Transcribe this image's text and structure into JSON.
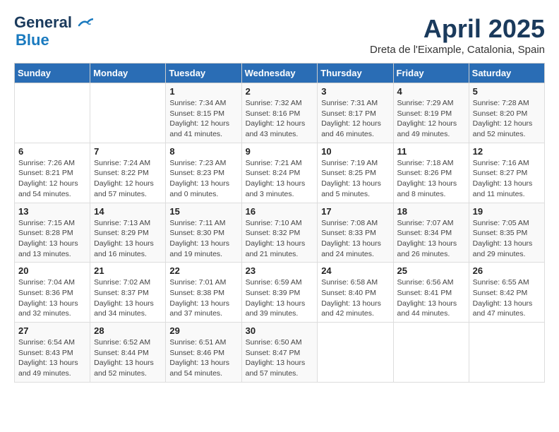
{
  "logo": {
    "line1": "General",
    "line2": "Blue"
  },
  "title": "April 2025",
  "location": "Dreta de l'Eixample, Catalonia, Spain",
  "weekdays": [
    "Sunday",
    "Monday",
    "Tuesday",
    "Wednesday",
    "Thursday",
    "Friday",
    "Saturday"
  ],
  "weeks": [
    [
      {
        "day": "",
        "info": ""
      },
      {
        "day": "",
        "info": ""
      },
      {
        "day": "1",
        "info": "Sunrise: 7:34 AM\nSunset: 8:15 PM\nDaylight: 12 hours and 41 minutes."
      },
      {
        "day": "2",
        "info": "Sunrise: 7:32 AM\nSunset: 8:16 PM\nDaylight: 12 hours and 43 minutes."
      },
      {
        "day": "3",
        "info": "Sunrise: 7:31 AM\nSunset: 8:17 PM\nDaylight: 12 hours and 46 minutes."
      },
      {
        "day": "4",
        "info": "Sunrise: 7:29 AM\nSunset: 8:19 PM\nDaylight: 12 hours and 49 minutes."
      },
      {
        "day": "5",
        "info": "Sunrise: 7:28 AM\nSunset: 8:20 PM\nDaylight: 12 hours and 52 minutes."
      }
    ],
    [
      {
        "day": "6",
        "info": "Sunrise: 7:26 AM\nSunset: 8:21 PM\nDaylight: 12 hours and 54 minutes."
      },
      {
        "day": "7",
        "info": "Sunrise: 7:24 AM\nSunset: 8:22 PM\nDaylight: 12 hours and 57 minutes."
      },
      {
        "day": "8",
        "info": "Sunrise: 7:23 AM\nSunset: 8:23 PM\nDaylight: 13 hours and 0 minutes."
      },
      {
        "day": "9",
        "info": "Sunrise: 7:21 AM\nSunset: 8:24 PM\nDaylight: 13 hours and 3 minutes."
      },
      {
        "day": "10",
        "info": "Sunrise: 7:19 AM\nSunset: 8:25 PM\nDaylight: 13 hours and 5 minutes."
      },
      {
        "day": "11",
        "info": "Sunrise: 7:18 AM\nSunset: 8:26 PM\nDaylight: 13 hours and 8 minutes."
      },
      {
        "day": "12",
        "info": "Sunrise: 7:16 AM\nSunset: 8:27 PM\nDaylight: 13 hours and 11 minutes."
      }
    ],
    [
      {
        "day": "13",
        "info": "Sunrise: 7:15 AM\nSunset: 8:28 PM\nDaylight: 13 hours and 13 minutes."
      },
      {
        "day": "14",
        "info": "Sunrise: 7:13 AM\nSunset: 8:29 PM\nDaylight: 13 hours and 16 minutes."
      },
      {
        "day": "15",
        "info": "Sunrise: 7:11 AM\nSunset: 8:30 PM\nDaylight: 13 hours and 19 minutes."
      },
      {
        "day": "16",
        "info": "Sunrise: 7:10 AM\nSunset: 8:32 PM\nDaylight: 13 hours and 21 minutes."
      },
      {
        "day": "17",
        "info": "Sunrise: 7:08 AM\nSunset: 8:33 PM\nDaylight: 13 hours and 24 minutes."
      },
      {
        "day": "18",
        "info": "Sunrise: 7:07 AM\nSunset: 8:34 PM\nDaylight: 13 hours and 26 minutes."
      },
      {
        "day": "19",
        "info": "Sunrise: 7:05 AM\nSunset: 8:35 PM\nDaylight: 13 hours and 29 minutes."
      }
    ],
    [
      {
        "day": "20",
        "info": "Sunrise: 7:04 AM\nSunset: 8:36 PM\nDaylight: 13 hours and 32 minutes."
      },
      {
        "day": "21",
        "info": "Sunrise: 7:02 AM\nSunset: 8:37 PM\nDaylight: 13 hours and 34 minutes."
      },
      {
        "day": "22",
        "info": "Sunrise: 7:01 AM\nSunset: 8:38 PM\nDaylight: 13 hours and 37 minutes."
      },
      {
        "day": "23",
        "info": "Sunrise: 6:59 AM\nSunset: 8:39 PM\nDaylight: 13 hours and 39 minutes."
      },
      {
        "day": "24",
        "info": "Sunrise: 6:58 AM\nSunset: 8:40 PM\nDaylight: 13 hours and 42 minutes."
      },
      {
        "day": "25",
        "info": "Sunrise: 6:56 AM\nSunset: 8:41 PM\nDaylight: 13 hours and 44 minutes."
      },
      {
        "day": "26",
        "info": "Sunrise: 6:55 AM\nSunset: 8:42 PM\nDaylight: 13 hours and 47 minutes."
      }
    ],
    [
      {
        "day": "27",
        "info": "Sunrise: 6:54 AM\nSunset: 8:43 PM\nDaylight: 13 hours and 49 minutes."
      },
      {
        "day": "28",
        "info": "Sunrise: 6:52 AM\nSunset: 8:44 PM\nDaylight: 13 hours and 52 minutes."
      },
      {
        "day": "29",
        "info": "Sunrise: 6:51 AM\nSunset: 8:46 PM\nDaylight: 13 hours and 54 minutes."
      },
      {
        "day": "30",
        "info": "Sunrise: 6:50 AM\nSunset: 8:47 PM\nDaylight: 13 hours and 57 minutes."
      },
      {
        "day": "",
        "info": ""
      },
      {
        "day": "",
        "info": ""
      },
      {
        "day": "",
        "info": ""
      }
    ]
  ]
}
